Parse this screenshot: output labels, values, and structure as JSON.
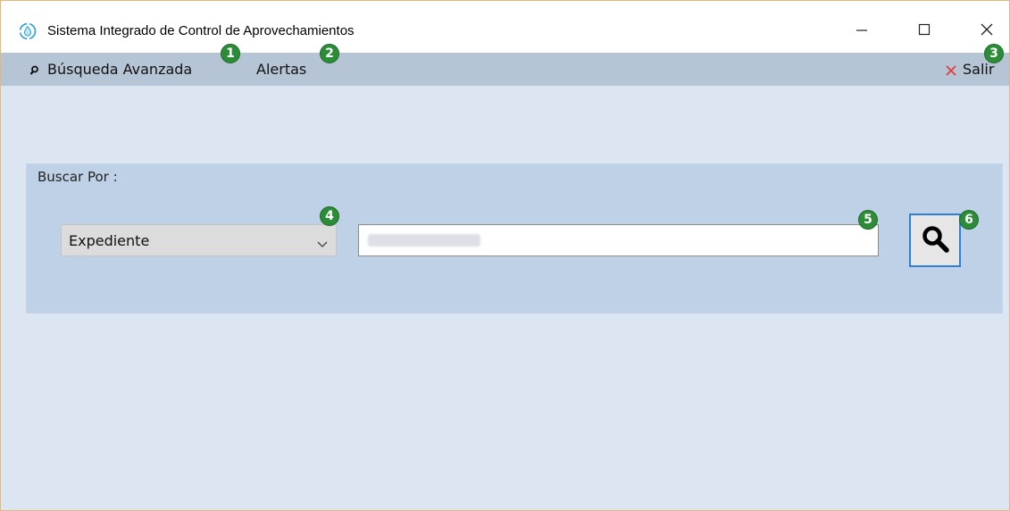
{
  "window": {
    "title": "Sistema Integrado de Control de Aprovechamientos",
    "app_icon": "water-drop-icon",
    "controls": {
      "minimize": "minimize-icon",
      "maximize": "maximize-icon",
      "close": "close-icon"
    }
  },
  "menu": {
    "advanced_search": {
      "icon": "search-icon",
      "label": "Búsqueda Avanzada"
    },
    "alerts": {
      "label": "Alertas"
    },
    "exit": {
      "icon": "close-icon",
      "label": "Salir",
      "icon_color": "#e23b3b"
    }
  },
  "search_panel": {
    "group_label": "Buscar Por :",
    "search_by": {
      "selected": "Expediente"
    },
    "search_value": {
      "value": ""
    },
    "search_button_icon": "search-icon"
  },
  "badges": [
    "1",
    "2",
    "3",
    "4",
    "5",
    "6"
  ],
  "colors": {
    "badge": "#2c8c37",
    "menubar": "#b6c5d5",
    "panel": "#bed1e6",
    "background": "#dbe6f2",
    "focus_border": "#2f7fd8"
  }
}
